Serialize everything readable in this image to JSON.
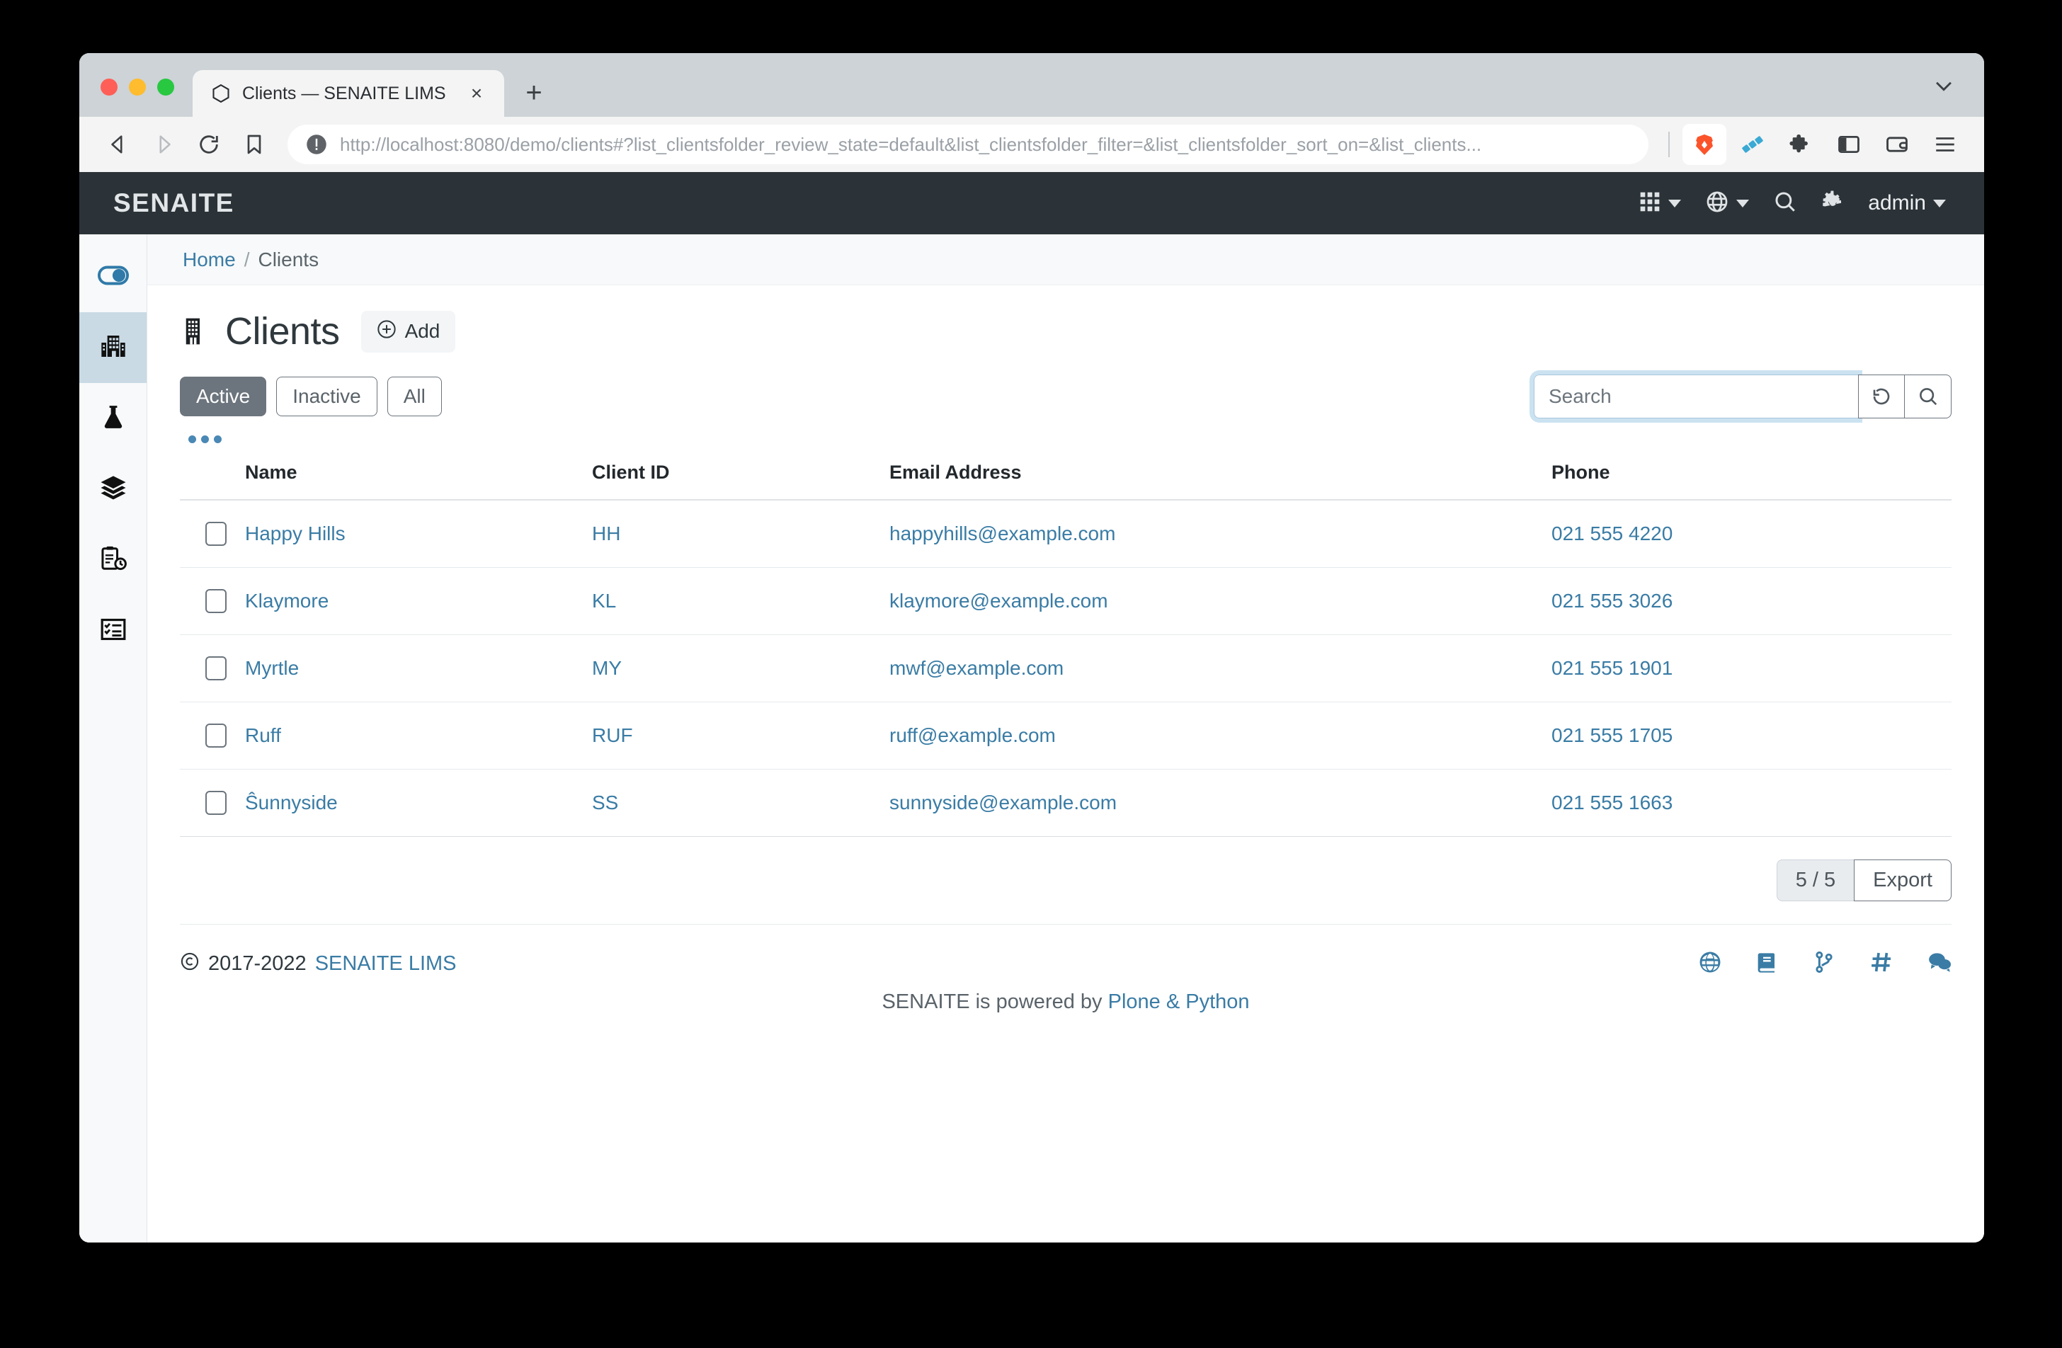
{
  "browser": {
    "tab": {
      "title": "Clients — SENAITE LIMS",
      "close_label": "×",
      "favicon": "brave-hex-icon"
    },
    "new_tab_label": "+",
    "nav": {
      "back": "back-arrow-icon",
      "forward": "forward-arrow-icon",
      "reload": "reload-icon",
      "bookmark": "bookmark-icon"
    },
    "url": {
      "scheme": "http://",
      "host": "localhost:8080",
      "path": "/demo/clients#?list_clientsfolder_review_state=default&list_clientsfolder_filter=&list_clientsfolder_sort_on=&list_clients...",
      "full": "http://localhost:8080/demo/clients#?list_clientsfolder_review_state=default&list_clientsfolder_filter=&list_clientsfolder_sort_on=&list_clients..."
    },
    "toolbar_icons": [
      "brave-lion-icon",
      "brave-rewards-icon",
      "extensions-puzzle-icon",
      "sidebar-panel-icon",
      "wallet-icon",
      "hamburger-menu-icon"
    ]
  },
  "header": {
    "brand": "SENAITE",
    "items": [
      {
        "name": "apps-grid-icon",
        "label": ""
      },
      {
        "name": "globe-language-icon",
        "label": ""
      },
      {
        "name": "search-icon",
        "label": ""
      },
      {
        "name": "gear-icon",
        "label": ""
      }
    ],
    "user": "admin"
  },
  "sidebar": {
    "items": [
      {
        "name": "toggle-sidebar-icon",
        "label": "Toggle",
        "active": false
      },
      {
        "name": "clients-building-icon",
        "label": "Clients",
        "active": true
      },
      {
        "name": "samples-flask-icon",
        "label": "Samples",
        "active": false
      },
      {
        "name": "batches-layers-icon",
        "label": "Batches",
        "active": false
      },
      {
        "name": "worksheets-clipboard-clock-icon",
        "label": "Worksheets",
        "active": false
      },
      {
        "name": "tasks-list-check-icon",
        "label": "Tasks",
        "active": false
      }
    ]
  },
  "breadcrumb": {
    "home": "Home",
    "separator": "/",
    "current": "Clients"
  },
  "page": {
    "title": "Clients",
    "title_icon": "building-icon",
    "add_label": "Add",
    "add_icon": "plus-circle-icon"
  },
  "filters": {
    "buttons": [
      {
        "label": "Active",
        "active": true
      },
      {
        "label": "Inactive",
        "active": false
      },
      {
        "label": "All",
        "active": false
      }
    ],
    "toggle_columns_icon": "three-dots-icon"
  },
  "search": {
    "placeholder": "Search",
    "value": "",
    "reset_icon": "reset-arrow-icon",
    "submit_icon": "search-icon"
  },
  "table": {
    "columns": [
      "",
      "Name",
      "Client ID",
      "Email Address",
      "Phone"
    ],
    "rows": [
      {
        "selected": false,
        "name": "Happy Hills",
        "client_id": "HH",
        "email": "happyhills@example.com",
        "phone": "021 555 4220"
      },
      {
        "selected": false,
        "name": "Klaymore",
        "client_id": "KL",
        "email": "klaymore@example.com",
        "phone": "021 555 3026"
      },
      {
        "selected": false,
        "name": "Myrtle",
        "client_id": "MY",
        "email": "mwf@example.com",
        "phone": "021 555 1901"
      },
      {
        "selected": false,
        "name": "Ruff",
        "client_id": "RUF",
        "email": "ruff@example.com",
        "phone": "021 555 1705"
      },
      {
        "selected": false,
        "name": "Ŝunnyside",
        "client_id": "SS",
        "email": "sunnyside@example.com",
        "phone": "021 555 1663"
      }
    ]
  },
  "pager": {
    "count": "5 / 5",
    "export_label": "Export"
  },
  "footer": {
    "copyright_symbol": "©",
    "years": "2017-2022",
    "product": "SENAITE LIMS",
    "powered_prefix": "SENAITE is powered by",
    "powered_link": "Plone & Python",
    "icons": [
      "globe-icon",
      "book-icon",
      "code-branch-icon",
      "hashtag-icon",
      "comments-icon"
    ]
  },
  "colors": {
    "header_bg": "#2b3338",
    "link": "#3a7ca5",
    "sidebar_active": "#c9dae5",
    "filter_active": "#6c757d"
  }
}
